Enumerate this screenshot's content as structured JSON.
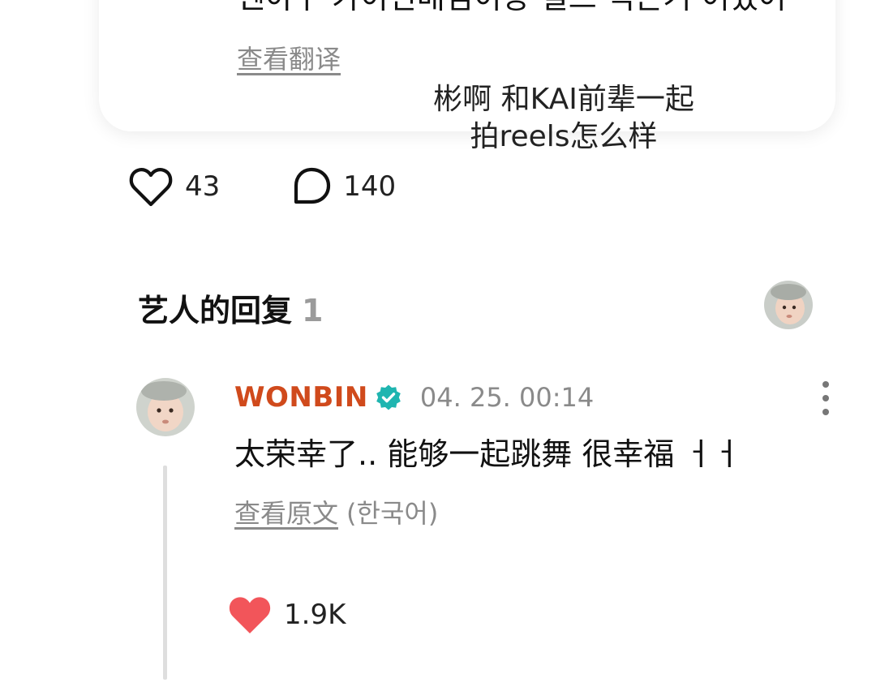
{
  "comment": {
    "text": "뻰아ㅏ 카이선배님이랑 릴스 찍은거 어땠어",
    "translate_link": "查看翻译",
    "caption_overlay": "彬啊 和KAI前辈一起拍reels怎么样"
  },
  "stats": {
    "likes": "43",
    "comments": "140"
  },
  "artist_replies": {
    "title": "艺人的回复",
    "count": "1"
  },
  "reply": {
    "author": "WONBIN",
    "timestamp": "04. 25. 00:14",
    "text": "太荣幸了.. 能够一起跳舞 很幸福 ㅓㅓ",
    "view_original_link": "查看原文",
    "original_language": "(한국어)",
    "likes": "1.9K"
  },
  "colors": {
    "author_name": "#d04a1c",
    "verified_badge": "#1fb5b0",
    "liked_heart": "#f2555a",
    "muted_text": "#8a8a8a"
  },
  "icons": {
    "like": "heart-outline-icon",
    "comment": "speech-bubble-icon",
    "verified": "verified-badge-icon",
    "more": "vertical-ellipsis-icon",
    "liked": "heart-filled-icon"
  }
}
